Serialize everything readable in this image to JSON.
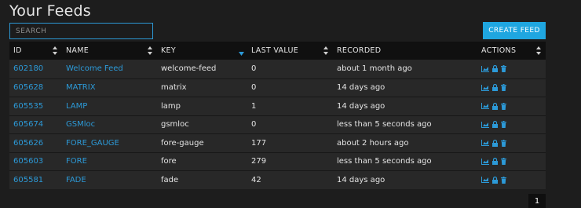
{
  "page": {
    "title": "Your Feeds"
  },
  "search": {
    "placeholder": "SEARCH",
    "value": ""
  },
  "toolbar": {
    "create_label": "CREATE FEED"
  },
  "colors": {
    "accent": "#1fa6e0",
    "link": "#2c9ad8",
    "header_bg": "#101010",
    "row_bg": "#282828"
  },
  "table": {
    "columns": [
      "ID",
      "NAME",
      "KEY",
      "LAST VALUE",
      "RECORDED",
      "ACTIONS"
    ],
    "sorted_column": "KEY",
    "action_icons": [
      "chart-icon",
      "lock-icon",
      "trash-icon"
    ],
    "rows": [
      {
        "id": "602180",
        "name": "Welcome Feed",
        "key": "welcome-feed",
        "last_value": "0",
        "recorded": "about 1 month ago"
      },
      {
        "id": "605628",
        "name": "MATRIX",
        "key": "matrix",
        "last_value": "0",
        "recorded": "14 days ago"
      },
      {
        "id": "605535",
        "name": "LAMP",
        "key": "lamp",
        "last_value": "1",
        "recorded": "14 days ago"
      },
      {
        "id": "605674",
        "name": "GSMloc",
        "key": "gsmloc",
        "last_value": "0",
        "recorded": "less than 5 seconds ago"
      },
      {
        "id": "605626",
        "name": "FORE_GAUGE",
        "key": "fore-gauge",
        "last_value": "177",
        "recorded": "about 2 hours ago"
      },
      {
        "id": "605603",
        "name": "FORE",
        "key": "fore",
        "last_value": "279",
        "recorded": "less than 5 seconds ago"
      },
      {
        "id": "605581",
        "name": "FADE",
        "key": "fade",
        "last_value": "42",
        "recorded": "14 days ago"
      }
    ]
  },
  "pagination": {
    "current_page": "1"
  }
}
